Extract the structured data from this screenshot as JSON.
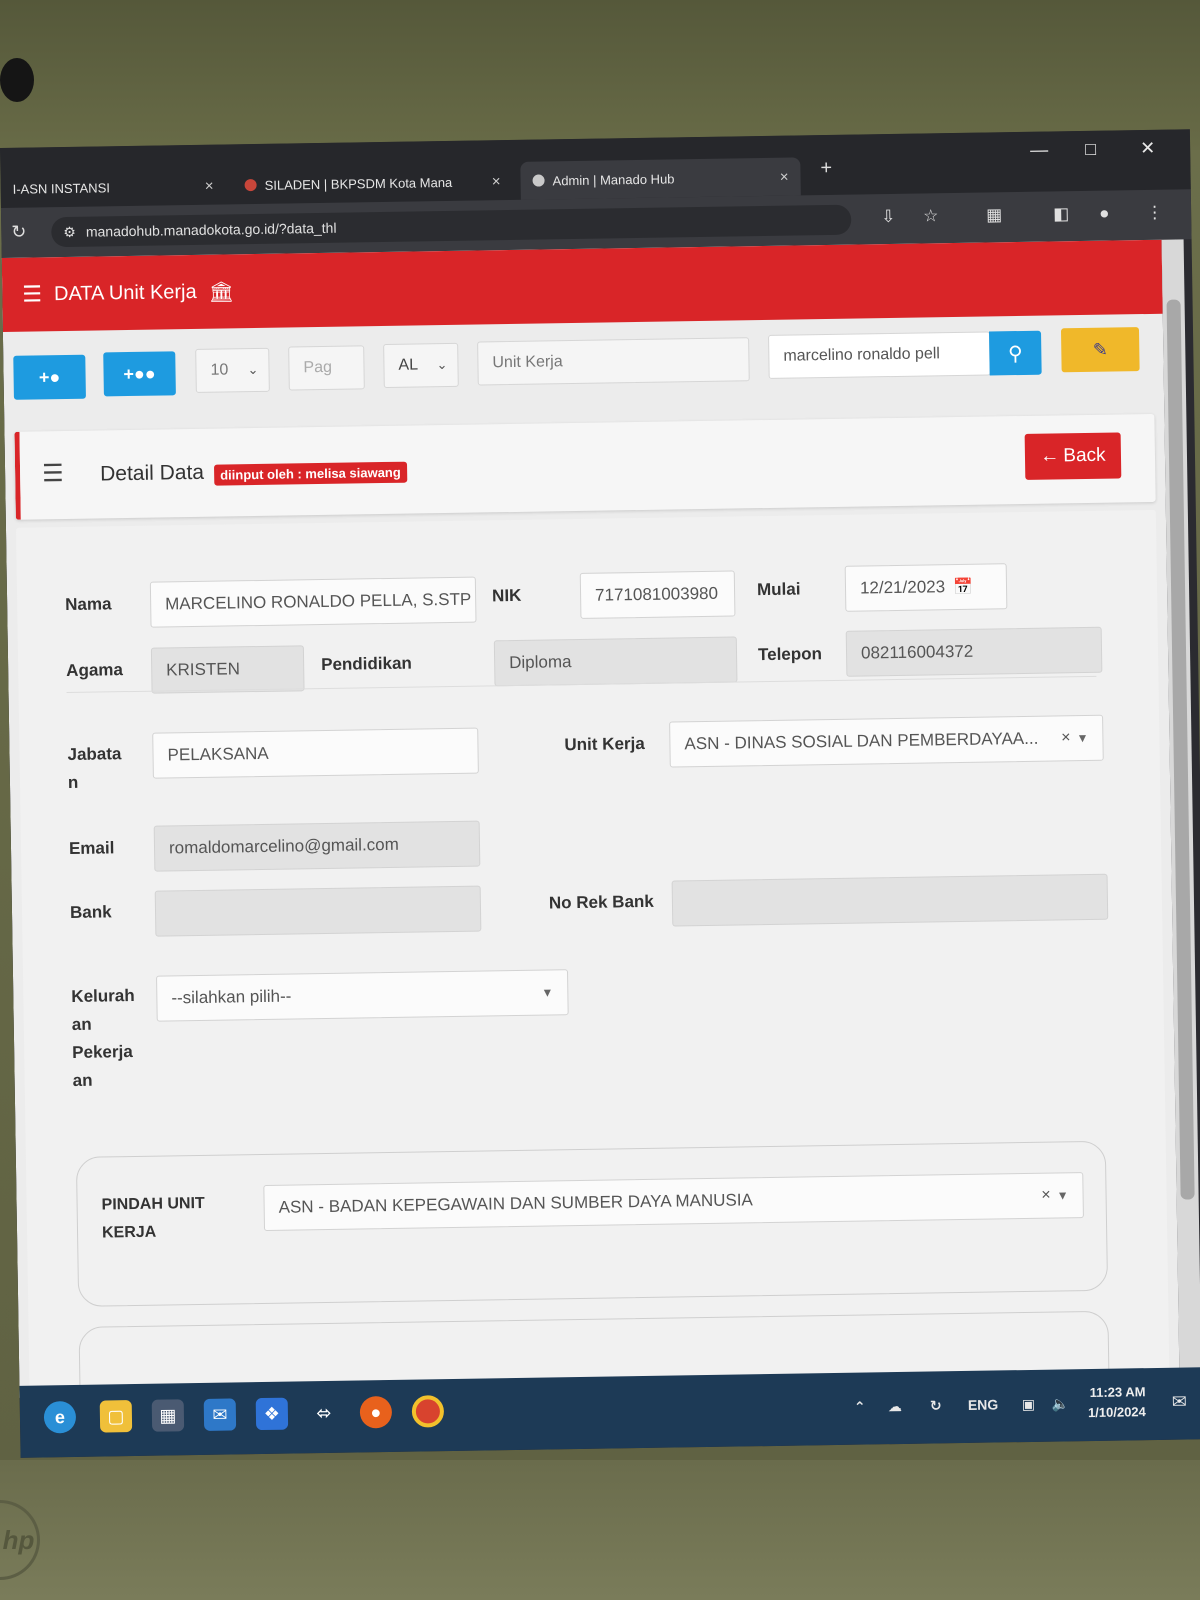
{
  "browser": {
    "tabs": [
      {
        "label": "I-ASN INSTANSI",
        "close": "×"
      },
      {
        "label": "SILADEN | BKPSDM Kota Mana",
        "close": "×"
      },
      {
        "label": "Admin | Manado Hub",
        "close": "×"
      }
    ],
    "new_tab": "+",
    "url": "manadohub.manadokota.go.id/?data_thl"
  },
  "nav": {
    "title": "DATA Unit Kerja"
  },
  "toolbar": {
    "page_size": "10",
    "page_placeholder": "Pag",
    "filter_value": "AL",
    "unit_kerja_placeholder": "Unit Kerja",
    "search_value": "marcelino ronaldo pell"
  },
  "detail": {
    "title": "Detail Data",
    "badge": "diinput oleh : melisa siawang",
    "back_label": "Back"
  },
  "form": {
    "nama_label": "Nama",
    "nama_value": "MARCELINO RONALDO PELLA, S.STP",
    "nik_label": "NIK",
    "nik_value": "7171081003980",
    "mulai_label": "Mulai",
    "mulai_value": "12/21/2023",
    "agama_label": "Agama",
    "agama_value": "KRISTEN",
    "pendidikan_label": "Pendidikan",
    "pendidikan_value": "Diploma",
    "telepon_label": "Telepon",
    "telepon_value": "082116004372",
    "jabatan_label_1": "Jabata",
    "jabatan_label_2": "n",
    "jabatan_value": "PELAKSANA",
    "unit_kerja_label": "Unit Kerja",
    "unit_kerja_value": "ASN - DINAS SOSIAL DAN PEMBERDAYAA...",
    "email_label": "Email",
    "email_value": "romaldomarcelino@gmail.com",
    "bank_label": "Bank",
    "bank_value": "",
    "norek_label": "No Rek Bank",
    "norek_value": "",
    "kelurahan_label_1": "Kelurah",
    "kelurahan_label_2": "an",
    "kelurahan_label_3": "Pekerja",
    "kelurahan_label_4": "an",
    "kelurahan_value": "--silahkan pilih--",
    "pindah_label_1": "PINDAH UNIT",
    "pindah_label_2": "KERJA",
    "pindah_value": "ASN - BADAN KEPEGAWAIN DAN SUMBER DAYA MANUSIA"
  },
  "tray": {
    "lang": "ENG",
    "time": "11:23 AM",
    "date": "1/10/2024"
  },
  "colors": {
    "brand_red": "#d92528",
    "accent_blue": "#1e9be0",
    "accent_yellow": "#f0b82a"
  }
}
